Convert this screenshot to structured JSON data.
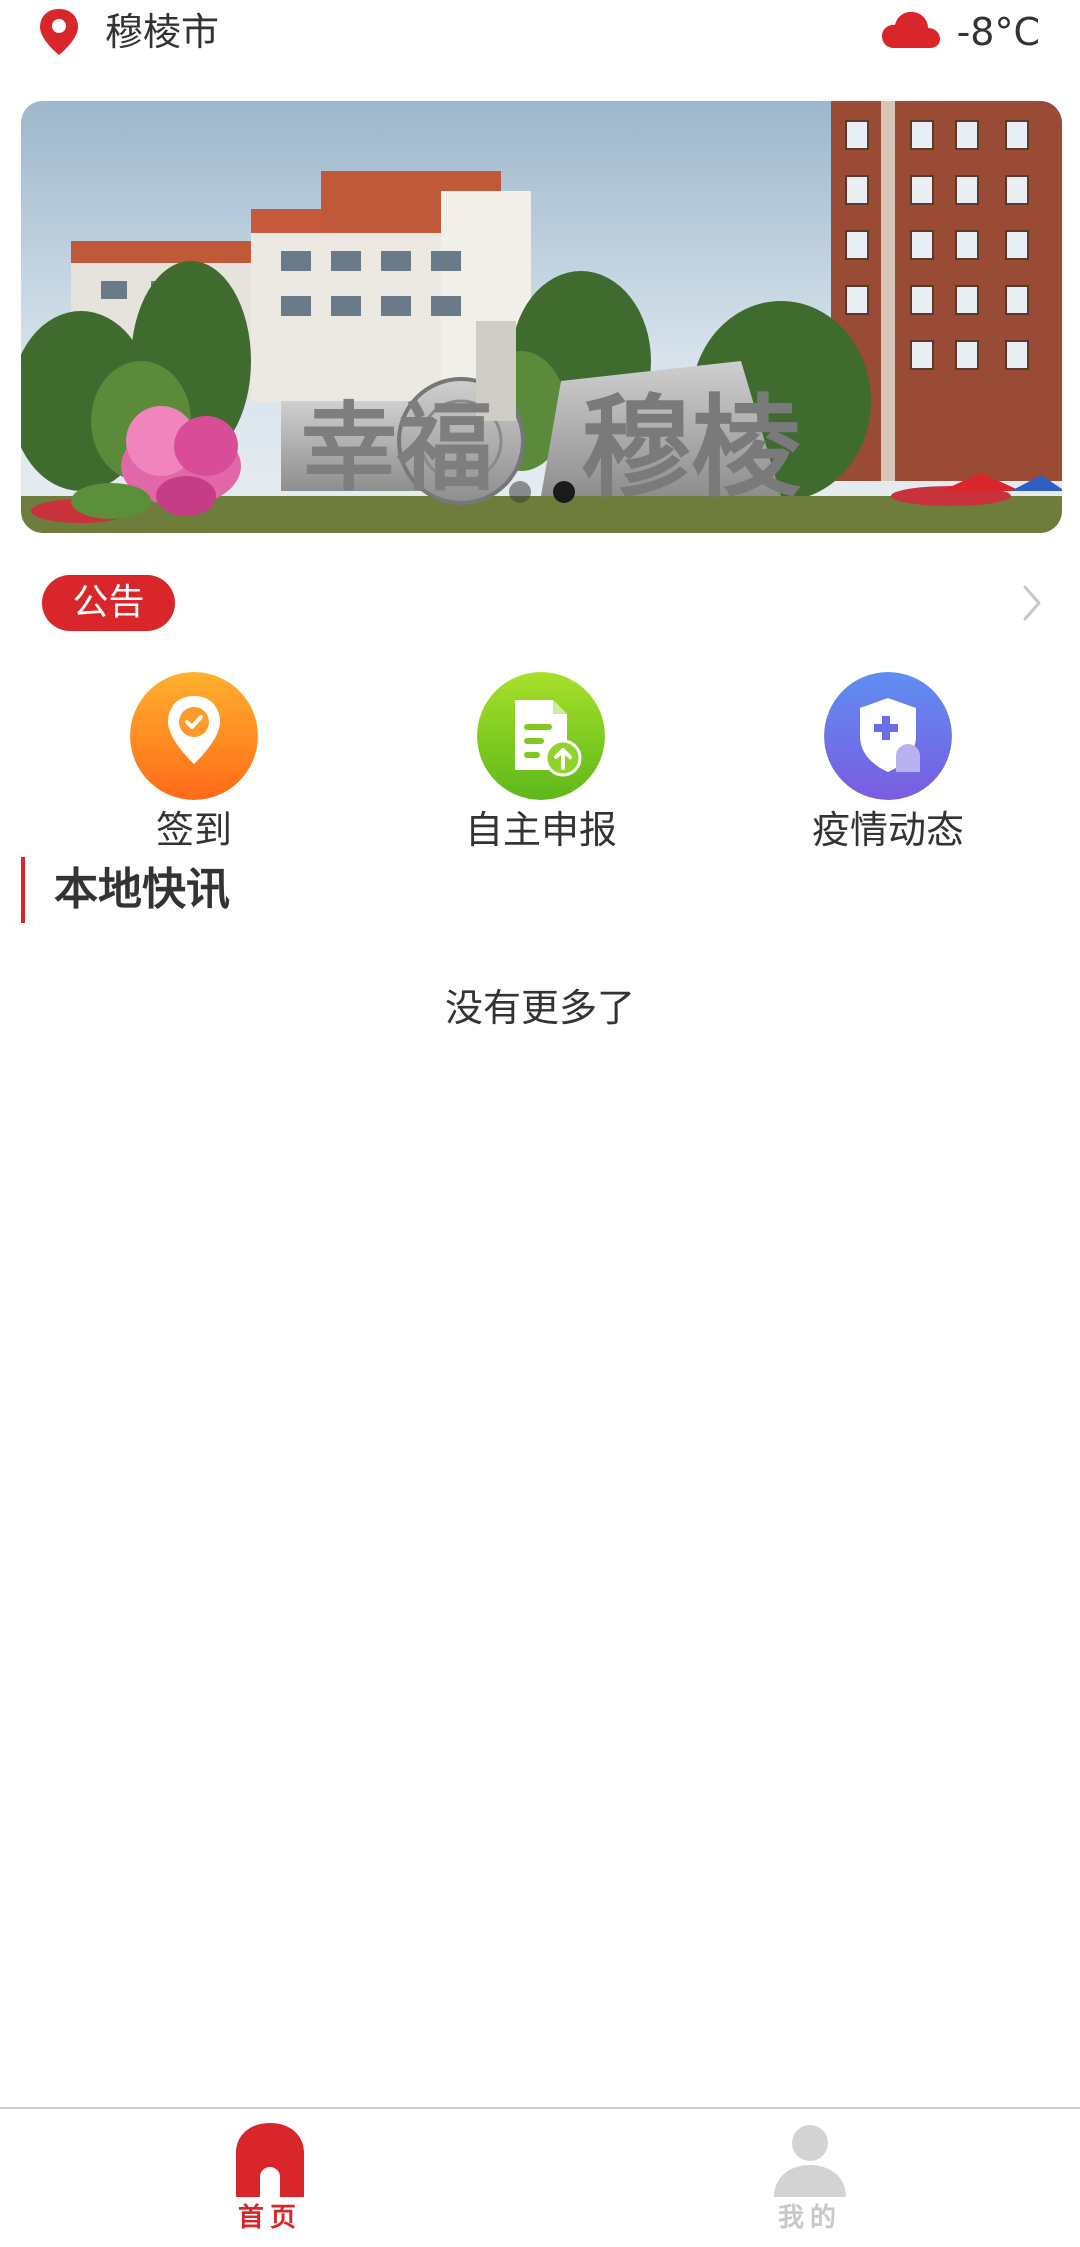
{
  "header": {
    "location_icon": "location-pin-icon",
    "city": "穆棱市",
    "weather_icon": "cloud-icon",
    "temperature": "-8°C"
  },
  "banner": {
    "sign_text": "幸福 穆棱",
    "slide_count": 2,
    "active_slide": 2
  },
  "notice": {
    "badge": "公告",
    "text": "",
    "arrow_icon": "chevron-right-icon"
  },
  "quick_actions": [
    {
      "label": "签到",
      "icon": "check-in-location-icon",
      "color": "#ff8a1f"
    },
    {
      "label": "自主申报",
      "icon": "document-upload-icon",
      "color": "#7ccb1c"
    },
    {
      "label": "疫情动态",
      "icon": "shield-medical-icon",
      "color": "#6b6fe6"
    }
  ],
  "section": {
    "title": "本地快讯",
    "empty_text": "没有更多了"
  },
  "tabbar": {
    "tabs": [
      {
        "label": "首页",
        "icon": "home-icon",
        "active": true
      },
      {
        "label": "我的",
        "icon": "user-icon",
        "active": false
      }
    ]
  },
  "colors": {
    "accent": "#d8262b",
    "text": "#333333",
    "inactive": "#c8c8c8"
  }
}
